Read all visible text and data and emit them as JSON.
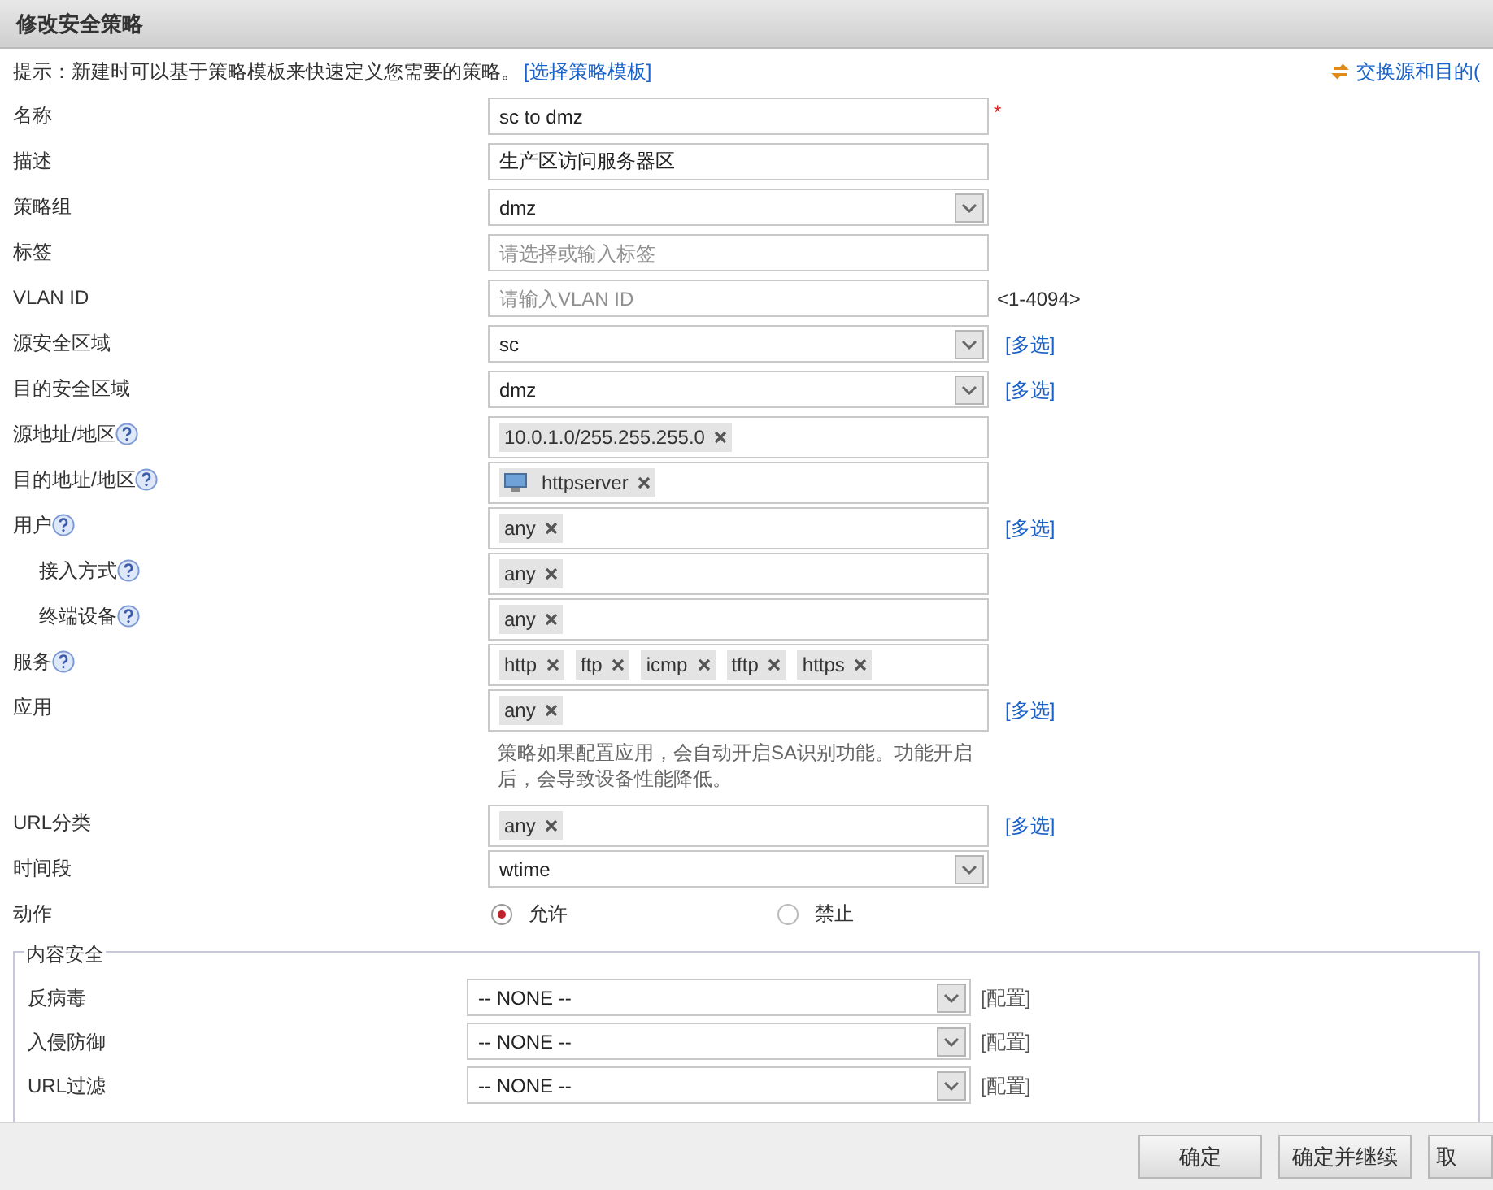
{
  "window": {
    "title": "修改安全策略"
  },
  "hint": {
    "text": "提示：新建时可以基于策略模板来快速定义您需要的策略。",
    "link": "[选择策略模板]"
  },
  "swap_link": "交换源和目的(",
  "fields": [
    {
      "label": "名称",
      "kind": "input",
      "value": "sc to dmz",
      "required_mark": "*"
    },
    {
      "label": "描述",
      "kind": "input",
      "value": "生产区访问服务器区"
    },
    {
      "label": "策略组",
      "kind": "select",
      "value": "dmz"
    },
    {
      "label": "标签",
      "kind": "input",
      "placeholder": "请选择或输入标签"
    },
    {
      "label": "VLAN ID",
      "kind": "input",
      "placeholder": "请输入VLAN ID",
      "suffix": "<1-4094>"
    },
    {
      "label": "源安全区域",
      "kind": "select",
      "value": "sc",
      "link": "[多选]"
    },
    {
      "label": "目的安全区域",
      "kind": "select",
      "value": "dmz",
      "link": "[多选]"
    },
    {
      "label": "源地址/地区",
      "kind": "tags",
      "help": true,
      "tags": [
        {
          "text": "10.0.1.0/255.255.255.0",
          "kind": "plain"
        }
      ]
    },
    {
      "label": "目的地址/地区",
      "kind": "tags",
      "help": true,
      "tags": [
        {
          "text": "httpserver",
          "kind": "host"
        }
      ]
    },
    {
      "label": "用户",
      "kind": "tags",
      "help": true,
      "tags": [
        {
          "text": "any",
          "kind": "plain"
        }
      ],
      "link": "[多选]",
      "children": [
        {
          "label": "接入方式",
          "kind": "tags",
          "help": true,
          "tags": [
            {
              "text": "any",
              "kind": "plain"
            }
          ]
        },
        {
          "label": "终端设备",
          "kind": "tags",
          "help": true,
          "tags": [
            {
              "text": "any",
              "kind": "plain"
            }
          ]
        }
      ]
    },
    {
      "label": "服务",
      "kind": "tags",
      "help": true,
      "tags": [
        {
          "text": "http",
          "kind": "plain"
        },
        {
          "text": "ftp",
          "kind": "plain"
        },
        {
          "text": "icmp",
          "kind": "plain"
        },
        {
          "text": "tftp",
          "kind": "plain"
        },
        {
          "text": "https",
          "kind": "plain"
        }
      ]
    },
    {
      "label": "应用",
      "kind": "tags",
      "tags": [
        {
          "text": "any",
          "kind": "plain"
        }
      ],
      "link": "[多选]",
      "note": "策略如果配置应用，会自动开启SA识别功能。功能开启后，会导致设备性能降低。"
    },
    {
      "label": "URL分类",
      "kind": "tags",
      "tags": [
        {
          "text": "any",
          "kind": "plain"
        }
      ],
      "link": "[多选]"
    },
    {
      "label": "时间段",
      "kind": "select",
      "value": "wtime"
    },
    {
      "label": "动作",
      "kind": "radio",
      "options": [
        {
          "label": "允许",
          "selected": true
        },
        {
          "label": "禁止",
          "selected": false
        }
      ]
    }
  ],
  "content_security": {
    "legend": "内容安全",
    "rows": [
      {
        "label": "反病毒",
        "value": "-- NONE --",
        "link": "[配置]"
      },
      {
        "label": "入侵防御",
        "value": "-- NONE --",
        "link": "[配置]"
      },
      {
        "label": "URL过滤",
        "value": "-- NONE --",
        "link": "[配置]"
      }
    ]
  },
  "buttons": [
    "确定",
    "确定并继续",
    "取"
  ]
}
